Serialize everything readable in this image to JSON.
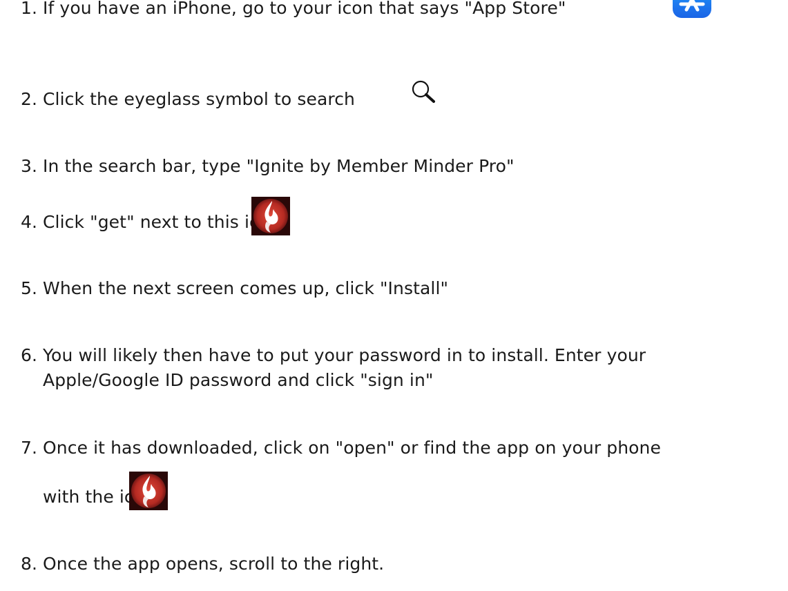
{
  "steps": [
    {
      "num": "1.",
      "text": "If you have an iPhone, go to your icon that says \"App Store\""
    },
    {
      "num": "2.",
      "text": "Click the eyeglass symbol to search"
    },
    {
      "num": "3.",
      "text": "In the search bar, type \"Ignite by Member Minder Pro\""
    },
    {
      "num": "4.",
      "text": "Click \"get\" next to this icon"
    },
    {
      "num": "5.",
      "text": "When the next screen comes up, click \"Install\""
    },
    {
      "num": "6.",
      "line1": "You will likely then have to put your password in to install. Enter your",
      "line2": "Apple/Google ID password and click \"sign in\""
    },
    {
      "num": "7.",
      "line1": "Once it has downloaded, click on \"open\" or find the app on your phone",
      "line2": "with the icon"
    },
    {
      "num": "8.",
      "text": "Once the app opens, scroll to the right."
    }
  ],
  "icons": {
    "app_store": "app-store-icon",
    "search": "magnifier-icon",
    "ignite": "ignite-flame-icon"
  },
  "colors": {
    "app_store_blue": "#1e7cf0",
    "ignite_red": "#c0392b",
    "ignite_dark": "#3a0d0d"
  }
}
